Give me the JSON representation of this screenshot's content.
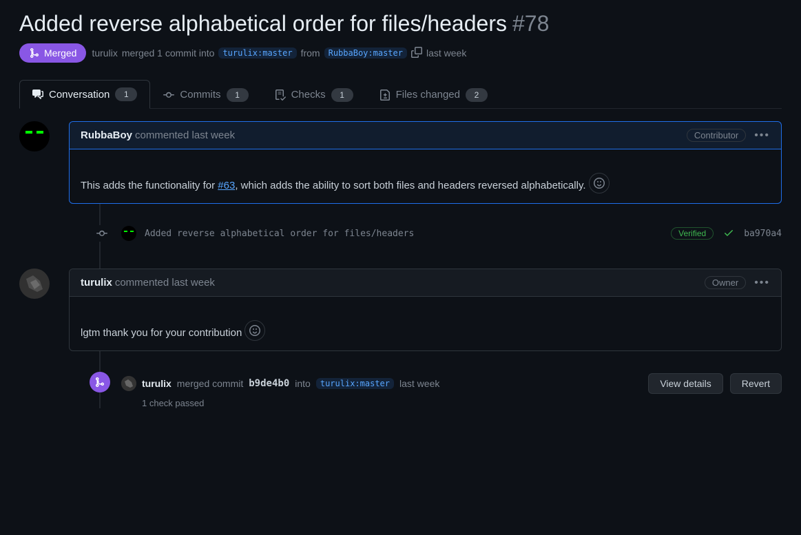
{
  "pr": {
    "title": "Added reverse alphabetical order for files/headers",
    "number": "#78",
    "state": "Merged",
    "meta_actor": "turulix",
    "meta_text_1": "merged 1 commit into",
    "base_branch": "turulix:master",
    "meta_text_2": "from",
    "head_branch": "RubbaBoy:master",
    "meta_time": "last week"
  },
  "tabs": {
    "conversation": {
      "label": "Conversation",
      "count": "1"
    },
    "commits": {
      "label": "Commits",
      "count": "1"
    },
    "checks": {
      "label": "Checks",
      "count": "1"
    },
    "files": {
      "label": "Files changed",
      "count": "2"
    }
  },
  "comment1": {
    "author": "RubbaBoy",
    "time": "commented last week",
    "role": "Contributor",
    "body_pre": "This adds the functionality for ",
    "issue_ref": "#63",
    "body_post": ", which adds the ability to sort both files and headers reversed alphabetically."
  },
  "commit": {
    "message": "Added reverse alphabetical order for files/headers",
    "verified": "Verified",
    "sha": "ba970a4"
  },
  "comment2": {
    "author": "turulix",
    "time": "commented last week",
    "role": "Owner",
    "body": "lgtm thank you for your contribution"
  },
  "merge_event": {
    "user": "turulix",
    "text1": "merged commit",
    "commit_sha": "b9de4b0",
    "text2": "into",
    "branch": "turulix:master",
    "time": "last week",
    "view_details": "View details",
    "revert": "Revert",
    "check_passed": "1 check passed"
  }
}
